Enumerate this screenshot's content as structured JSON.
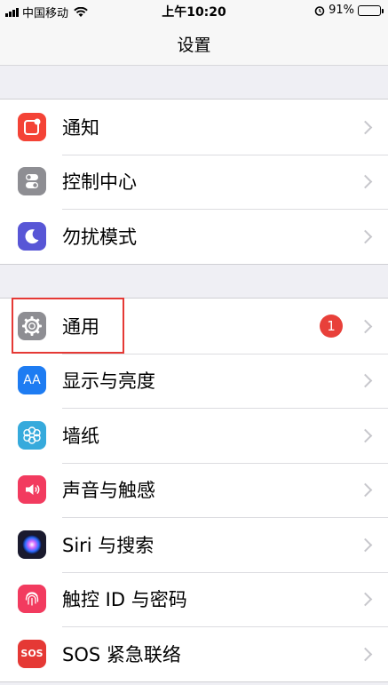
{
  "status_bar": {
    "carrier": "中国移动",
    "time": "上午10:20",
    "battery_percent": "91%",
    "battery_level": 0.91
  },
  "nav": {
    "title": "设置"
  },
  "groups": [
    {
      "items": [
        {
          "label": "通知",
          "icon": "notifications-icon",
          "color": "#f44336"
        },
        {
          "label": "控制中心",
          "icon": "control-center-icon",
          "color": "#8e8e93"
        },
        {
          "label": "勿扰模式",
          "icon": "moon-icon",
          "color": "#5856d6"
        }
      ]
    },
    {
      "items": [
        {
          "label": "通用",
          "icon": "gear-icon",
          "color": "#8e8e93",
          "badge": "1"
        },
        {
          "label": "显示与亮度",
          "icon": "display-brightness-icon",
          "color": "#1e7cf2"
        },
        {
          "label": "墙纸",
          "icon": "flower-icon",
          "color": "#36aadc"
        },
        {
          "label": "声音与触感",
          "icon": "speaker-icon",
          "color": "#f23b5f"
        },
        {
          "label": "Siri 与搜索",
          "icon": "siri-icon",
          "color": "#1a1a2e"
        },
        {
          "label": "触控 ID 与密码",
          "icon": "fingerprint-icon",
          "color": "#f23b5f"
        },
        {
          "label": "SOS 紧急联络",
          "icon": "sos-icon",
          "color": "#e53935",
          "icon_text": "SOS"
        }
      ]
    }
  ],
  "display_icon_text": "AA",
  "highlight_color": "#e53935"
}
